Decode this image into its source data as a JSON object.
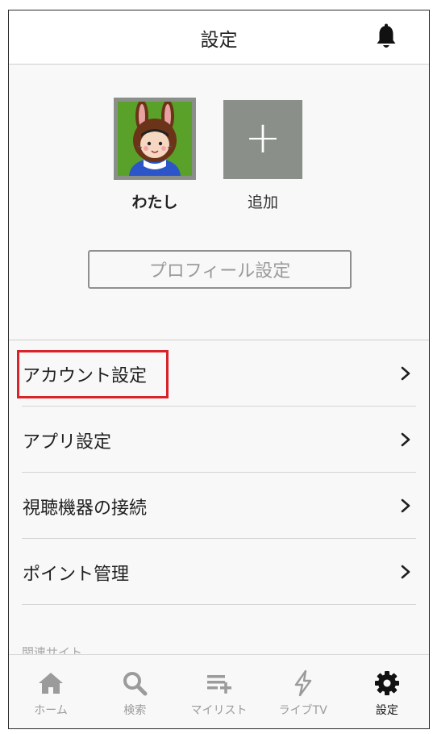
{
  "header": {
    "title": "設定",
    "bell_icon": "bell-icon"
  },
  "profiles": [
    {
      "name": "わたし",
      "avatar_icon": "bunny-hood-avatar"
    },
    {
      "name": "追加",
      "icon": "plus-icon"
    }
  ],
  "profile_button_label": "プロフィール設定",
  "menu": [
    {
      "label": "アカウント設定",
      "highlighted": true
    },
    {
      "label": "アプリ設定"
    },
    {
      "label": "視聴機器の接続"
    },
    {
      "label": "ポイント管理"
    }
  ],
  "related_heading": "関連サイト",
  "bottom_nav": [
    {
      "label": "ホーム",
      "icon": "home-icon",
      "active": false
    },
    {
      "label": "検索",
      "icon": "search-icon",
      "active": false
    },
    {
      "label": "マイリスト",
      "icon": "mylist-add-icon",
      "active": false
    },
    {
      "label": "ライブTV",
      "icon": "lightning-icon",
      "active": false
    },
    {
      "label": "設定",
      "icon": "gear-icon",
      "active": true
    }
  ],
  "colors": {
    "highlight": "#d8232a",
    "tile": "#8b8f8a",
    "avatar_bg": "#5aa12a"
  }
}
